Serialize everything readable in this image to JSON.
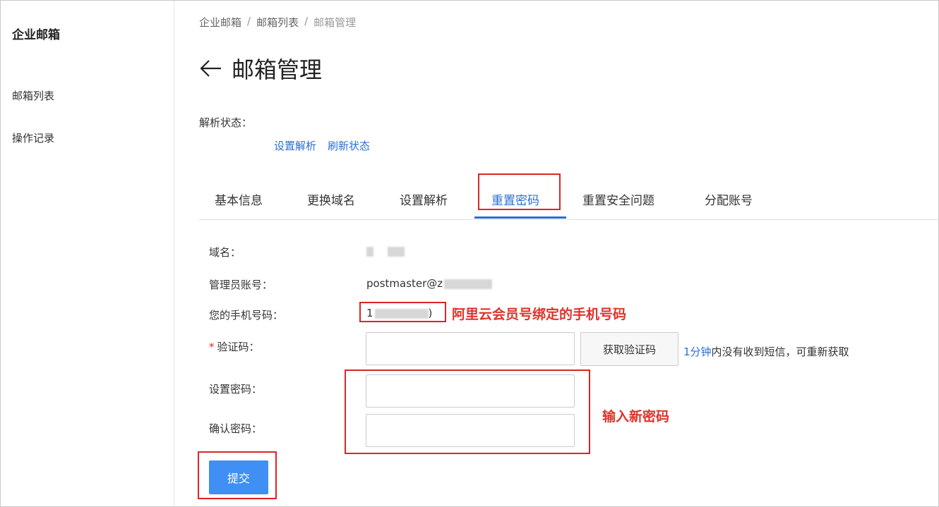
{
  "sidebar": {
    "brand": "企业邮箱",
    "items": [
      {
        "label": "邮箱列表"
      },
      {
        "label": "操作记录"
      }
    ]
  },
  "breadcrumb": {
    "items": [
      "企业邮箱",
      "邮箱列表",
      "邮箱管理"
    ],
    "separator": "/"
  },
  "header": {
    "title": "邮箱管理"
  },
  "status": {
    "label": "解析状态：",
    "links": [
      "设置解析",
      "刷新状态"
    ]
  },
  "tabs": [
    "基本信息",
    "更换域名",
    "设置解析",
    "重置密码",
    "重置安全问题",
    "分配账号"
  ],
  "form": {
    "domain_label": "域名：",
    "admin_label": "管理员账号：",
    "admin_value": "postmaster@z",
    "phone_label": "您的手机号码：",
    "phone_value_start": "1",
    "phone_value_end": ")",
    "code_required": "*",
    "code_label": "验证码：",
    "sms_button": "获取验证码",
    "sms_hint_time": "1分钟",
    "sms_hint_text": "内没有收到短信，可重新获取",
    "password_label": "设置密码：",
    "confirm_label": "确认密码：",
    "submit": "提交"
  },
  "annotations": {
    "phone_note": "阿里云会员号绑定的手机号码",
    "password_note": "输入新密码"
  },
  "colors": {
    "accent": "#2a6fd1",
    "primary_button": "#3f8ff5",
    "annotation": "#d92626"
  }
}
